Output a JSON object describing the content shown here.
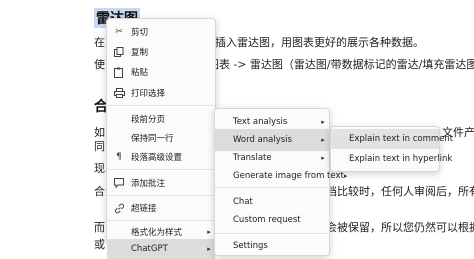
{
  "document": {
    "heading1": "雷达图",
    "line1_prefix": "在",
    "line1_suffix": "插入雷达图，用图表更好的展示各种数据。",
    "line2_prefix": "使",
    "line2_suffix": "图表 -> 雷达图（雷达图/带数据标记的雷达/填充雷达图）",
    "heading2": "合",
    "line3_prefix": "如",
    "line3_suffix": "文件产",
    "line4_prefix": "同",
    "line5_prefix": "现",
    "line6_prefix": "合",
    "line6_suffix": "档比较时，任何人审阅后，所有",
    "line7_prefix": "而",
    "line7_suffix": "会被保留，所以您仍然可以根据",
    "line8_prefix": "或"
  },
  "context_menu": {
    "items": [
      {
        "icon": "scissors-icon",
        "label": "剪切"
      },
      {
        "icon": "copy-icon",
        "label": "复制"
      },
      {
        "icon": "paste-icon",
        "label": "粘贴"
      },
      {
        "icon": "print-icon",
        "label": "打印选择"
      },
      {
        "icon": "",
        "label": "段前分页"
      },
      {
        "icon": "",
        "label": "保持同一行"
      },
      {
        "icon": "paragraph-icon",
        "label": "段落高级设置"
      },
      {
        "icon": "comment-icon",
        "label": "添加批注"
      },
      {
        "icon": "link-icon",
        "label": "超链接"
      },
      {
        "icon": "",
        "label": "格式化为样式"
      },
      {
        "icon": "",
        "label": "ChatGPT"
      }
    ]
  },
  "chatgpt_menu": {
    "items": [
      "Text analysis",
      "Word analysis",
      "Translate",
      "Generate image from text",
      "Chat",
      "Custom request",
      "Settings"
    ]
  },
  "word_analysis_menu": {
    "items": [
      "Explain text in comment",
      "Explain text in hyperlink"
    ]
  },
  "colors": {
    "selection": "#c7d9f2",
    "highlight": "#dcdcdc"
  }
}
